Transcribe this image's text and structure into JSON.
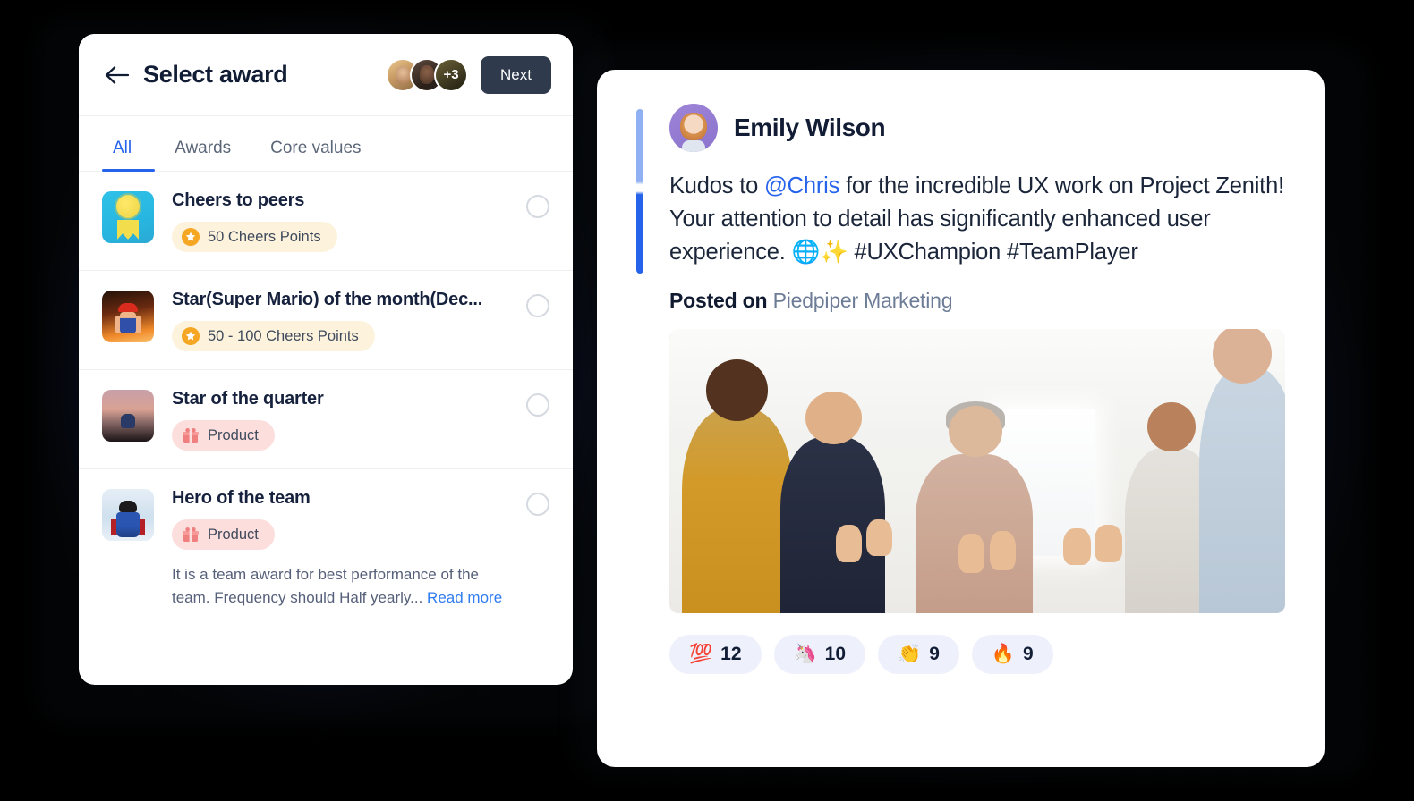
{
  "panel": {
    "title": "Select award",
    "back_icon": "arrow-left-icon",
    "next_label": "Next",
    "avatars": [
      {
        "name": "teammate-1"
      },
      {
        "name": "teammate-2"
      },
      {
        "name": "overflow",
        "label": "+3"
      }
    ],
    "tabs": [
      {
        "label": "All",
        "active": true
      },
      {
        "label": "Awards",
        "active": false
      },
      {
        "label": "Core values",
        "active": false
      }
    ],
    "awards": [
      {
        "name": "Cheers to peers",
        "thumb": "medal-ribbon-icon",
        "badge": {
          "label": "50 Cheers Points",
          "icon": "star-coin-icon",
          "kind": "points"
        },
        "selected": false
      },
      {
        "name": "Star(Super Mario) of the month(Dec...",
        "thumb": "super-mario-figure",
        "badge": {
          "label": "50 - 100 Cheers Points",
          "icon": "star-coin-icon",
          "kind": "points"
        },
        "selected": false
      },
      {
        "name": "Star of the quarter",
        "thumb": "superhero-sunset-photo",
        "badge": {
          "label": "Product",
          "icon": "gift-box-icon",
          "kind": "product"
        },
        "selected": false
      },
      {
        "name": "Hero of the team",
        "thumb": "superman-figure-photo",
        "badge": {
          "label": "Product",
          "icon": "gift-box-icon",
          "kind": "product"
        },
        "description": "It is a team award for best performance of the team. Frequency should Half yearly...",
        "read_more": "Read more",
        "selected": false
      }
    ]
  },
  "post": {
    "author": "Emily Wilson",
    "avatar": "emily-wilson-avatar",
    "message_pre": "Kudos to ",
    "mention": "@Chris",
    "message_post": " for the incredible UX work on Project Zenith! Your attention to detail has significantly enhanced user experience. 🌐✨ #UXChampion #TeamPlayer",
    "posted_on_label": "Posted on",
    "workspace": "Piedpiper Marketing",
    "photo_alt": "team-celebration-photo",
    "reactions": [
      {
        "emoji": "💯",
        "name": "hundred-points-reaction",
        "count": "12"
      },
      {
        "emoji": "🦄",
        "name": "unicorn-reaction",
        "count": "10"
      },
      {
        "emoji": "👏",
        "name": "clapping-hands-reaction",
        "count": "9"
      },
      {
        "emoji": "🔥",
        "name": "fire-reaction",
        "count": "9"
      }
    ]
  },
  "colors": {
    "accent_blue": "#2563eb",
    "next_button": "#2f3b4d",
    "points_pill": "#fdf3dd",
    "product_pill": "#fcdedd",
    "reaction_pill": "#eef0fb",
    "background": "#000000"
  }
}
